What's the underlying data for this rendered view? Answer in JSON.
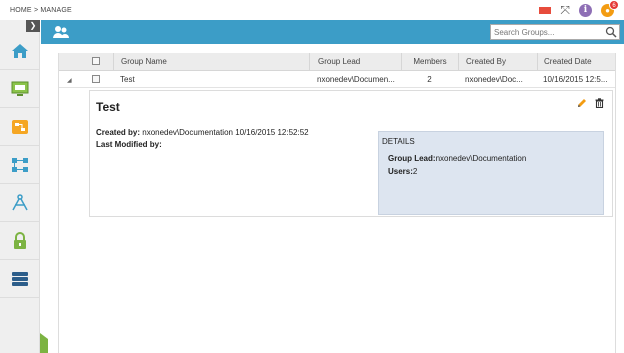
{
  "breadcrumb": "HOME > MANAGE",
  "top_icons": {
    "notifications_count": "6",
    "flag_color": "#e74c3c",
    "info_color": "#8e6fb5",
    "bell_color": "#f39c12"
  },
  "header": {
    "accent": "#3c9dc7"
  },
  "search": {
    "placeholder": "Search Groups..."
  },
  "sidebar": {
    "items": [
      {
        "icon": "home-icon"
      },
      {
        "icon": "monitor-icon"
      },
      {
        "icon": "workflow-icon"
      },
      {
        "icon": "network-icon"
      },
      {
        "icon": "compass-icon"
      },
      {
        "icon": "lock-icon"
      },
      {
        "icon": "server-icon"
      }
    ]
  },
  "table": {
    "columns": [
      "Group Name",
      "Group Lead",
      "Members",
      "Created By",
      "Created Date"
    ],
    "rows": [
      {
        "group_name": "Test",
        "group_lead": "nxonedev\\Documen...",
        "members": "2",
        "created_by": "nxonedev\\Doc...",
        "created_date": "10/16/2015 12:5..."
      }
    ]
  },
  "detail": {
    "title": "Test",
    "created_by_label": "Created by:",
    "created_by_value": " nxonedev\\Documentation 10/16/2015 12:52:52",
    "last_modified_label": "Last Modified by:",
    "details_header": "DETAILS",
    "group_lead_label": "Group Lead:",
    "group_lead_value": "nxonedev\\Documentation",
    "users_label": "Users:",
    "users_value": "2"
  }
}
